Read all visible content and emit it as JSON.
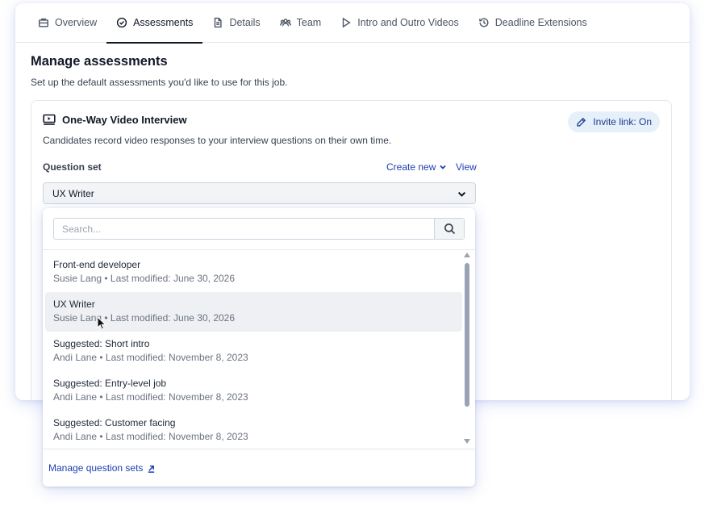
{
  "tabs": [
    {
      "label": "Overview",
      "icon": "briefcase-icon"
    },
    {
      "label": "Assessments",
      "icon": "check-circle-icon",
      "active": true
    },
    {
      "label": "Details",
      "icon": "document-icon"
    },
    {
      "label": "Team",
      "icon": "users-icon"
    },
    {
      "label": "Intro and Outro Videos",
      "icon": "play-icon"
    },
    {
      "label": "Deadline Extensions",
      "icon": "history-icon"
    }
  ],
  "page": {
    "title": "Manage assessments",
    "subtitle": "Set up the default assessments you'd like to use for this job."
  },
  "panel": {
    "title": "One-Way Video Interview",
    "invite_label": "Invite link: On",
    "description": "Candidates record video responses to your interview questions on their own time.",
    "question_set_label": "Question set",
    "create_new": "Create new",
    "view": "View",
    "selected": "UX Writer"
  },
  "dropdown": {
    "search_placeholder": "Search...",
    "items": [
      {
        "title": "Front-end developer",
        "meta": "Susie Lang • Last modified: June 30, 2026"
      },
      {
        "title": "UX Writer",
        "meta": "Susie Lang • Last modified: June 30, 2026"
      },
      {
        "title": "Suggested: Short intro",
        "meta": "Andi Lane • Last modified: November 8, 2023"
      },
      {
        "title": "Suggested: Entry-level job",
        "meta": "Andi Lane • Last modified: November 8, 2023"
      },
      {
        "title": "Suggested: Customer facing",
        "meta": "Andi Lane • Last modified: November 8, 2023"
      }
    ],
    "manage_label": "Manage question sets"
  },
  "colors": {
    "accent": "#1e40af",
    "invite_bg": "#e6f0fb",
    "hover_row": "#eef0f3"
  }
}
